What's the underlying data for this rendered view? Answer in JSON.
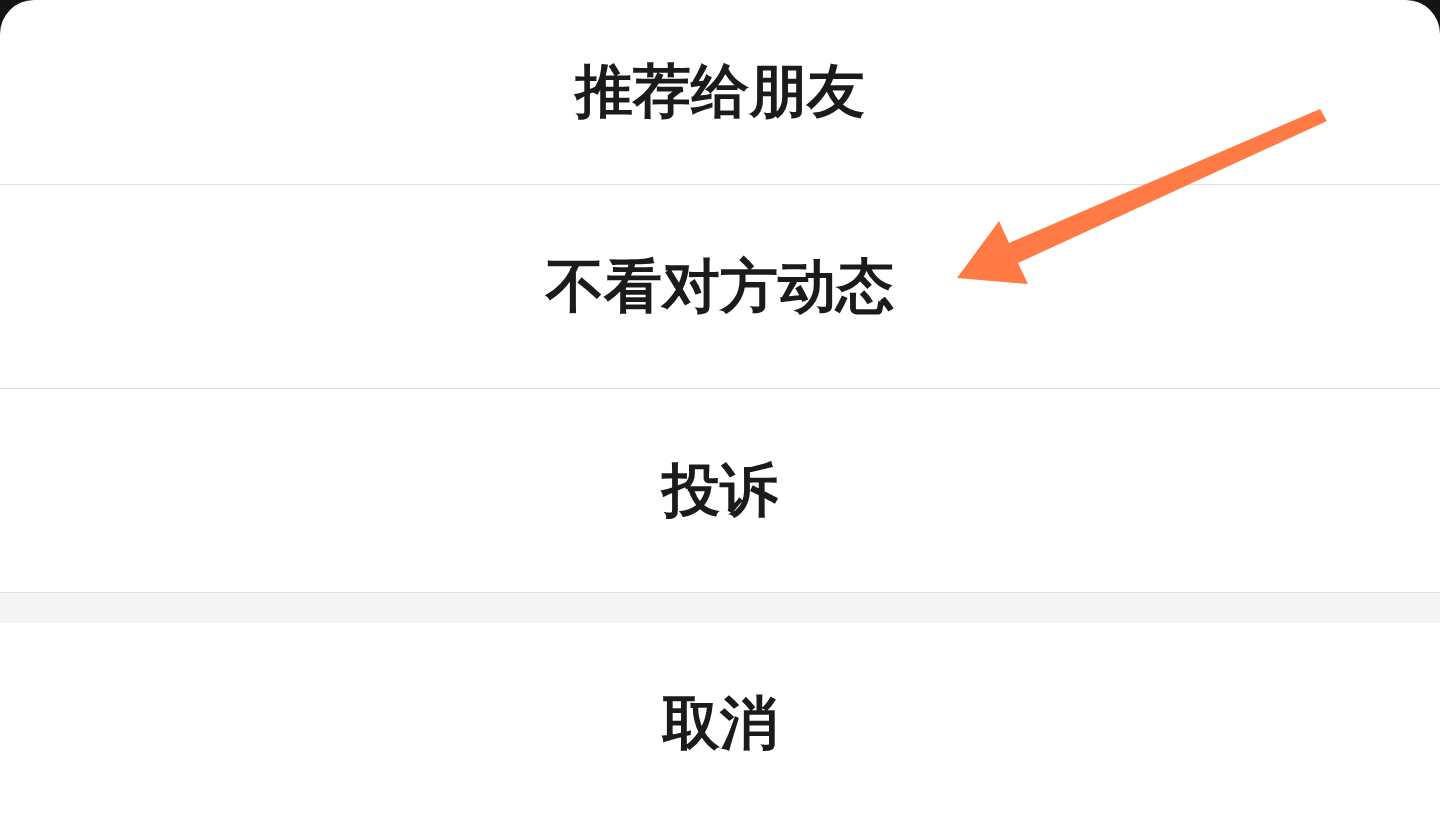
{
  "sheet": {
    "items": [
      {
        "label": "推荐给朋友",
        "marked": false
      },
      {
        "label": "不看对方动态",
        "marked": true
      },
      {
        "label": "投诉",
        "marked": false
      }
    ],
    "cancel": {
      "label": "取消"
    }
  }
}
